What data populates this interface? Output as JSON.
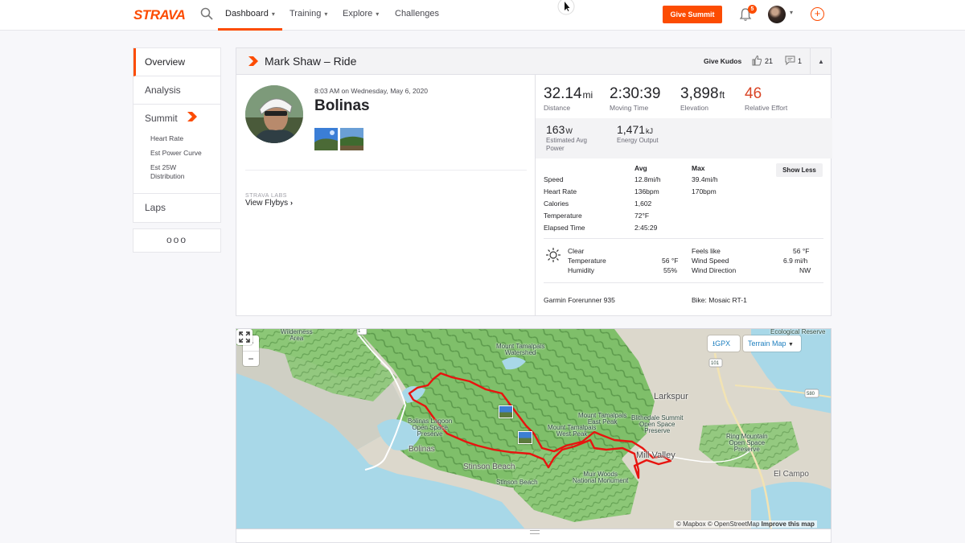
{
  "brand": {
    "logo": "STRAVA",
    "accent": "#fc4c02"
  },
  "topnav": {
    "items": [
      {
        "label": "Dashboard",
        "chevron": true
      },
      {
        "label": "Training",
        "chevron": true
      },
      {
        "label": "Explore",
        "chevron": true
      },
      {
        "label": "Challenges",
        "chevron": false
      }
    ],
    "give_summit": "Give Summit",
    "notifications_count": "5"
  },
  "sidenav": {
    "overview": "Overview",
    "analysis": "Analysis",
    "summit": "Summit",
    "summit_sub": [
      "Heart Rate",
      "Est Power Curve",
      "Est 25W Distribution"
    ],
    "laps": "Laps",
    "more": "ooo"
  },
  "activity": {
    "header_title": "Mark Shaw – Ride",
    "give_kudos": "Give Kudos",
    "kudos_count": "21",
    "comment_count": "1",
    "date": "8:03 AM on Wednesday, May 6, 2020",
    "name": "Bolinas",
    "labs": "STRAVA LABS",
    "flybys": "View Flybys"
  },
  "stats": {
    "distance": {
      "value": "32.14",
      "unit": "mi",
      "label": "Distance"
    },
    "moving_time": {
      "value": "2:30:39",
      "label": "Moving Time"
    },
    "elevation": {
      "value": "3,898",
      "unit": "ft",
      "label": "Elevation"
    },
    "relative_effort": {
      "value": "46",
      "label": "Relative Effort"
    },
    "power": {
      "value": "163",
      "unit": "W",
      "label": "Estimated Avg Power"
    },
    "energy": {
      "value": "1,471",
      "unit": "kJ",
      "label": "Energy Output"
    }
  },
  "table": {
    "avg_header": "Avg",
    "max_header": "Max",
    "show_less": "Show Less",
    "rows": [
      {
        "label": "Speed",
        "avg": "12.8mi/h",
        "max": "39.4mi/h"
      },
      {
        "label": "Heart Rate",
        "avg": "136bpm",
        "max": "170bpm"
      },
      {
        "label": "Calories",
        "avg": "1,602",
        "max": ""
      },
      {
        "label": "Temperature",
        "avg": "72°F",
        "max": ""
      },
      {
        "label": "Elapsed Time",
        "avg": "2:45:29",
        "max": ""
      }
    ]
  },
  "weather": {
    "condition": "Clear",
    "temperature_label": "Temperature",
    "temperature": "56 °F",
    "humidity_label": "Humidity",
    "humidity": "55%",
    "feels_like_label": "Feels like",
    "feels_like": "56 °F",
    "wind_speed_label": "Wind Speed",
    "wind_speed": "6.9 mi/h",
    "wind_dir_label": "Wind Direction",
    "wind_dir": "NW"
  },
  "device": "Garmin Forerunner 935",
  "bike": "Bike: Mosaic RT-1",
  "map": {
    "gpx": "GPX",
    "map_type": "Terrain Map",
    "zoom_in": "+",
    "zoom_out": "−",
    "attribution_mapbox": "© Mapbox",
    "attribution_osm": "© OpenStreetMap",
    "attribution_improve": "Improve this map",
    "labels": {
      "wilderness": "Wilderness\nArea",
      "tamalpais_watershed": "Mount Tamalpais\nWatershed",
      "ecological": "Ecological Reserve",
      "larkspur": "Larkspur",
      "bolinas_lagoon": "Bolinas Lagoon\nOpen Space\nPreserve",
      "east_peak": "Mount Tamalpais\nEast Peak",
      "west_peak": "Mount Tamalpais\nWest Peak",
      "blithedale": "Blithedale Summit\nOpen Space\nPreserve",
      "ring_mountain": "Ring Mountain\nOpen Space\nPreserve",
      "bolinas": "Bolinas",
      "stinson": "Stinson Beach",
      "stinson_small": "Stinson Beach",
      "mill_valley": "Mill Valley",
      "muir_woods": "Muir Woods\nNational Monument",
      "el_campo": "El Campo",
      "hwy1": "1",
      "hwy101": "101",
      "hwy580": "580"
    }
  }
}
